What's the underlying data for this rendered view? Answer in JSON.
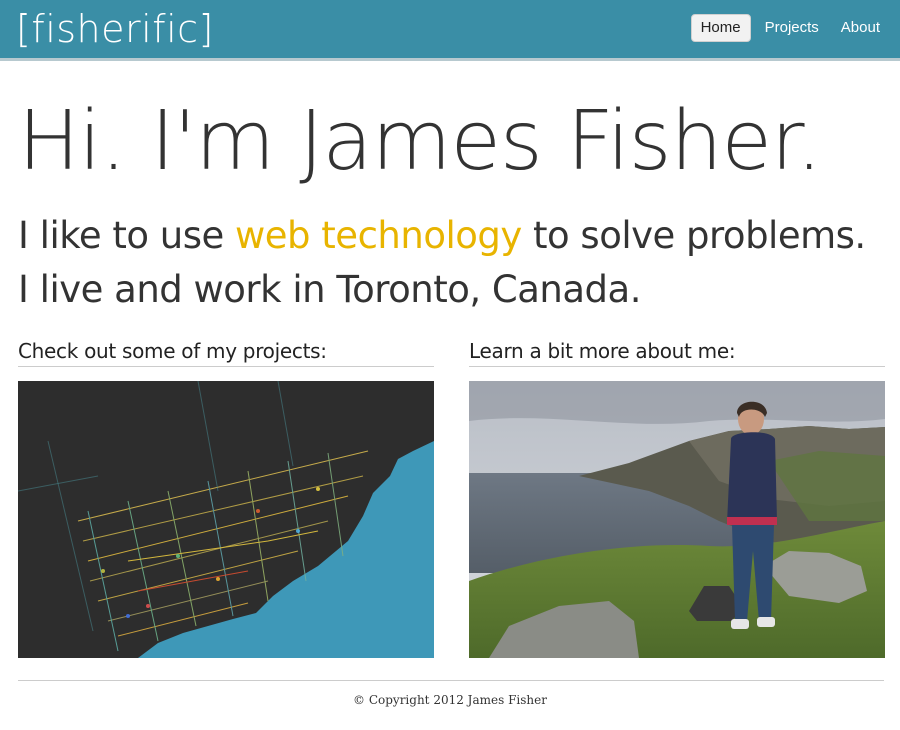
{
  "brand": "[fisherific]",
  "nav": {
    "home": "Home",
    "projects": "Projects",
    "about": "About"
  },
  "hero": {
    "title": "Hi. I'm James Fisher.",
    "line1_before": "I like to use ",
    "line1_accent": "web technology",
    "line1_after": " to solve problems.",
    "line2": "I live and work in Toronto, Canada."
  },
  "sections": {
    "projects_heading": "Check out some of my projects:",
    "about_heading": "Learn a bit more about me:"
  },
  "footer": {
    "copyright": "© Copyright 2012 James Fisher"
  },
  "colors": {
    "topbar": "#3a8ea6",
    "accent": "#e8b400",
    "map_land": "#2d2d2d",
    "map_water": "#3e98b8"
  }
}
